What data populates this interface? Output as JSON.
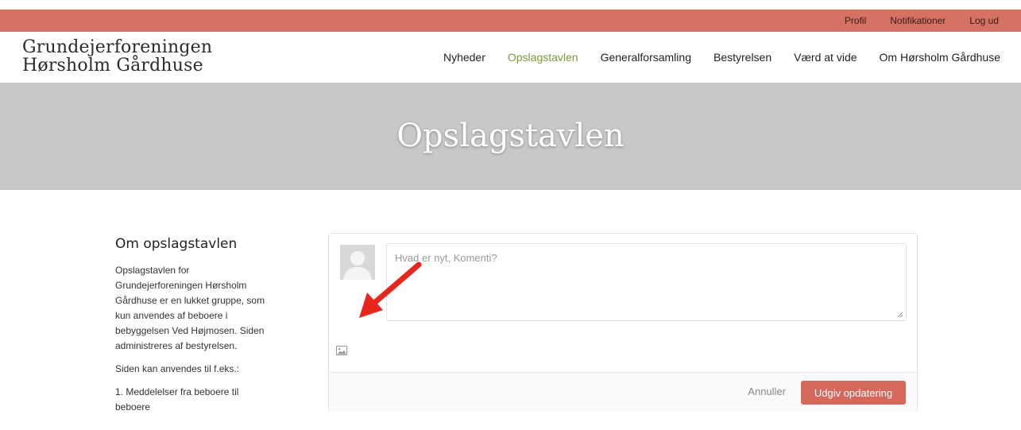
{
  "topbar": {
    "links": [
      "Profil",
      "Notifikationer",
      "Log ud"
    ],
    "color": "#d57263"
  },
  "header": {
    "logo_line1": "Grundejerforeningen",
    "logo_line2": "Hørsholm Gårdhuse",
    "nav": [
      "Nyheder",
      "Opslagstavlen",
      "Generalforsamling",
      "Bestyrelsen",
      "Værd at vide",
      "Om Hørsholm Gårdhuse"
    ],
    "active_nav": "Opslagstavlen",
    "active_color": "#7a9a36"
  },
  "hero": {
    "title": "Opslagstavlen"
  },
  "sidebar": {
    "heading": "Om opslagstavlen",
    "paragraphs": [
      "Opslagstavlen for Grundejerforeningen Hørsholm Gårdhuse er en lukket gruppe, som kun anvendes af beboere i bebyggelsen Ved Højmosen. Siden administreres af bestyrelsen.",
      "Siden kan anvendes til f.eks.:",
      "1. Meddelelser fra beboere til beboere"
    ]
  },
  "composer": {
    "placeholder": "Hvad er nyt, Komenti?",
    "cancel_label": "Annuller",
    "publish_label": "Udgiv opdatering",
    "publish_color": "#d5685a",
    "image_icon": "image-icon",
    "avatar_icon": "default-avatar-icon"
  },
  "annotation": {
    "arrow_color": "#e8261c"
  }
}
